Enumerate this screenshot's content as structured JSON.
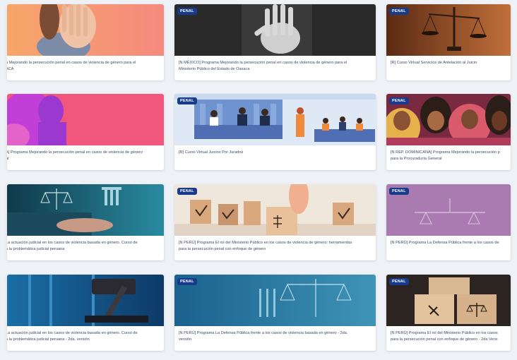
{
  "badge_label": "PENAL",
  "colors": {
    "badge_bg": "#173a8a",
    "page_bg": "#eef1f5"
  },
  "cards": [
    {
      "title": "a Mejorando la persecución penal en casos de violencia de género para el\nACA",
      "badge": false
    },
    {
      "title": "[N MÉXICO] Programa Mejorando la persecución penal en casos de violencia de género para el\nMinisterio Público del Estado de Oaxaca",
      "badge": true
    },
    {
      "title": "[R] Curso Virtual Servicios de Antelación al Juicio",
      "badge": true
    },
    {
      "title": "A] Programa Mejorando la persecución penal en casos de violencia de género\nal",
      "badge": false
    },
    {
      "title": "[R] Curso Virtual Juicios Por Jurados",
      "badge": true
    },
    {
      "title": "[N REP. DOMINICANA] Programa Mejorando la persecución p\npara la Procuraduría General",
      "badge": true
    },
    {
      "title": "La actuación judicial en los casos de violencia basada en género. Curso de\na la problemática judicial peruana",
      "badge": false
    },
    {
      "title": "[N PERÚ] Programa El rol del Ministerio Público en los casos de violencia de género: herramientas\npara la persecución penal con enfoque de género",
      "badge": true
    },
    {
      "title": "[N PERÚ] Programa La Defensa Pública frente a los casos de",
      "badge": true
    },
    {
      "title": "La actuación judicial en los casos de violencia basada en género. Curso de\na la problemática judicial peruana - 2da. versión",
      "badge": false
    },
    {
      "title": "[N PERÚ] Programa La Defensa Pública frente a los casos de violencia basada en género - 2da.\nversión",
      "badge": true
    },
    {
      "title": "[N PERÚ] Programa El rol del Ministerio Público en los casos\npara la persecución penal con enfoque de género - 2da Versi",
      "badge": true
    }
  ]
}
